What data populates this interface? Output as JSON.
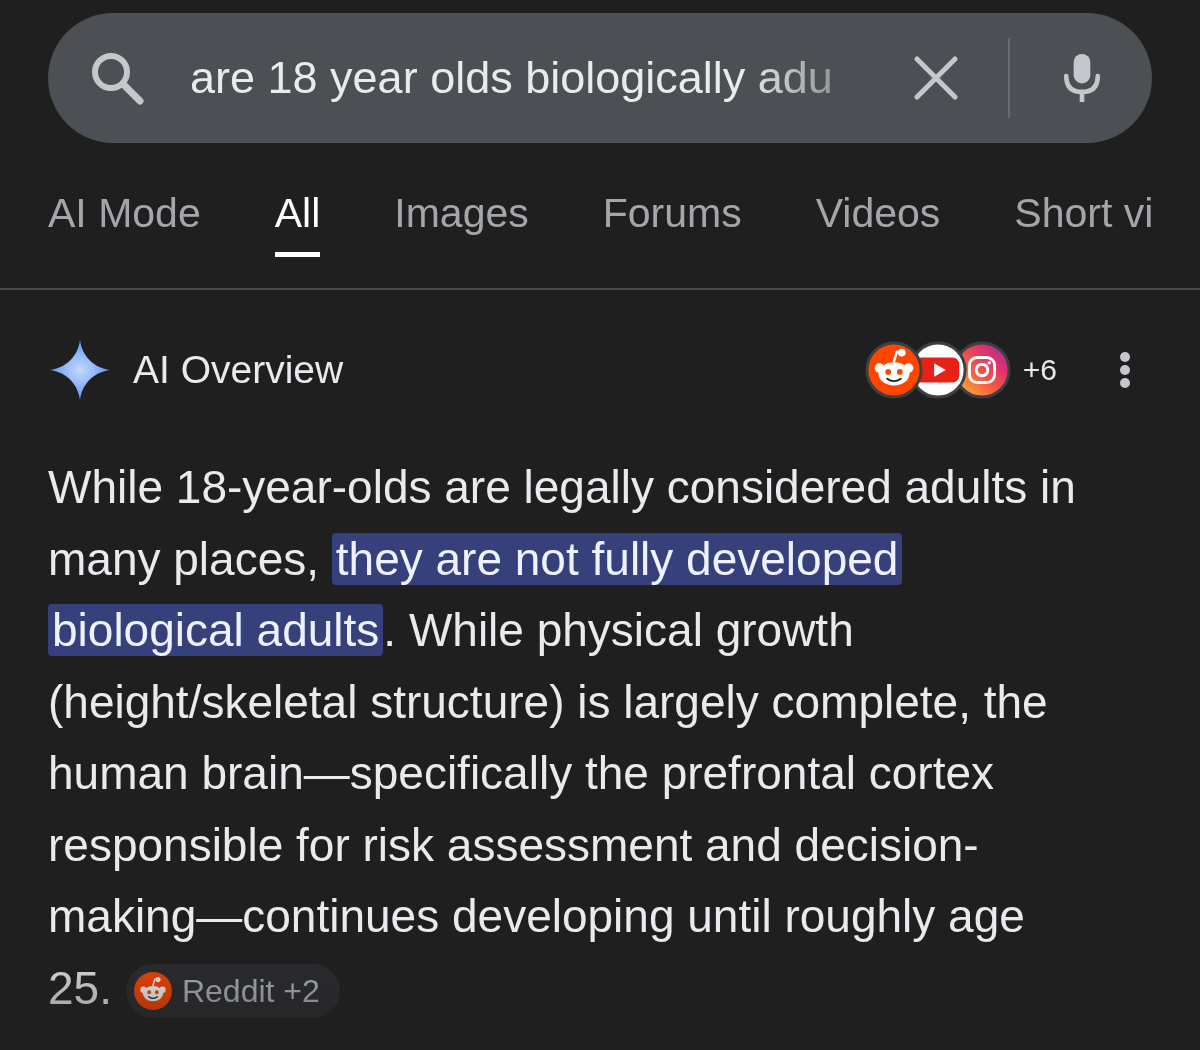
{
  "search": {
    "value": "are 18 year olds biologically adu"
  },
  "tabs": [
    {
      "label": "AI Mode",
      "selected": false
    },
    {
      "label": "All",
      "selected": true
    },
    {
      "label": "Images",
      "selected": false
    },
    {
      "label": "Forums",
      "selected": false
    },
    {
      "label": "Videos",
      "selected": false
    },
    {
      "label": "Short vi",
      "selected": false
    }
  ],
  "overview": {
    "title": "AI Overview",
    "source_count": "+6",
    "text": [
      {
        "text": "While 18-year-olds are legally considered adults in many places, ",
        "highlighted": false
      },
      {
        "text": "they are not fully developed biological adults",
        "highlighted": true
      },
      {
        "text": ". While physical growth (height/skeletal structure) is largely complete, the human brain—specifically the prefrontal cortex responsible for risk assessment and decision-making—continues developing until roughly age 25.",
        "highlighted": false
      }
    ],
    "citation": "Reddit +2"
  }
}
